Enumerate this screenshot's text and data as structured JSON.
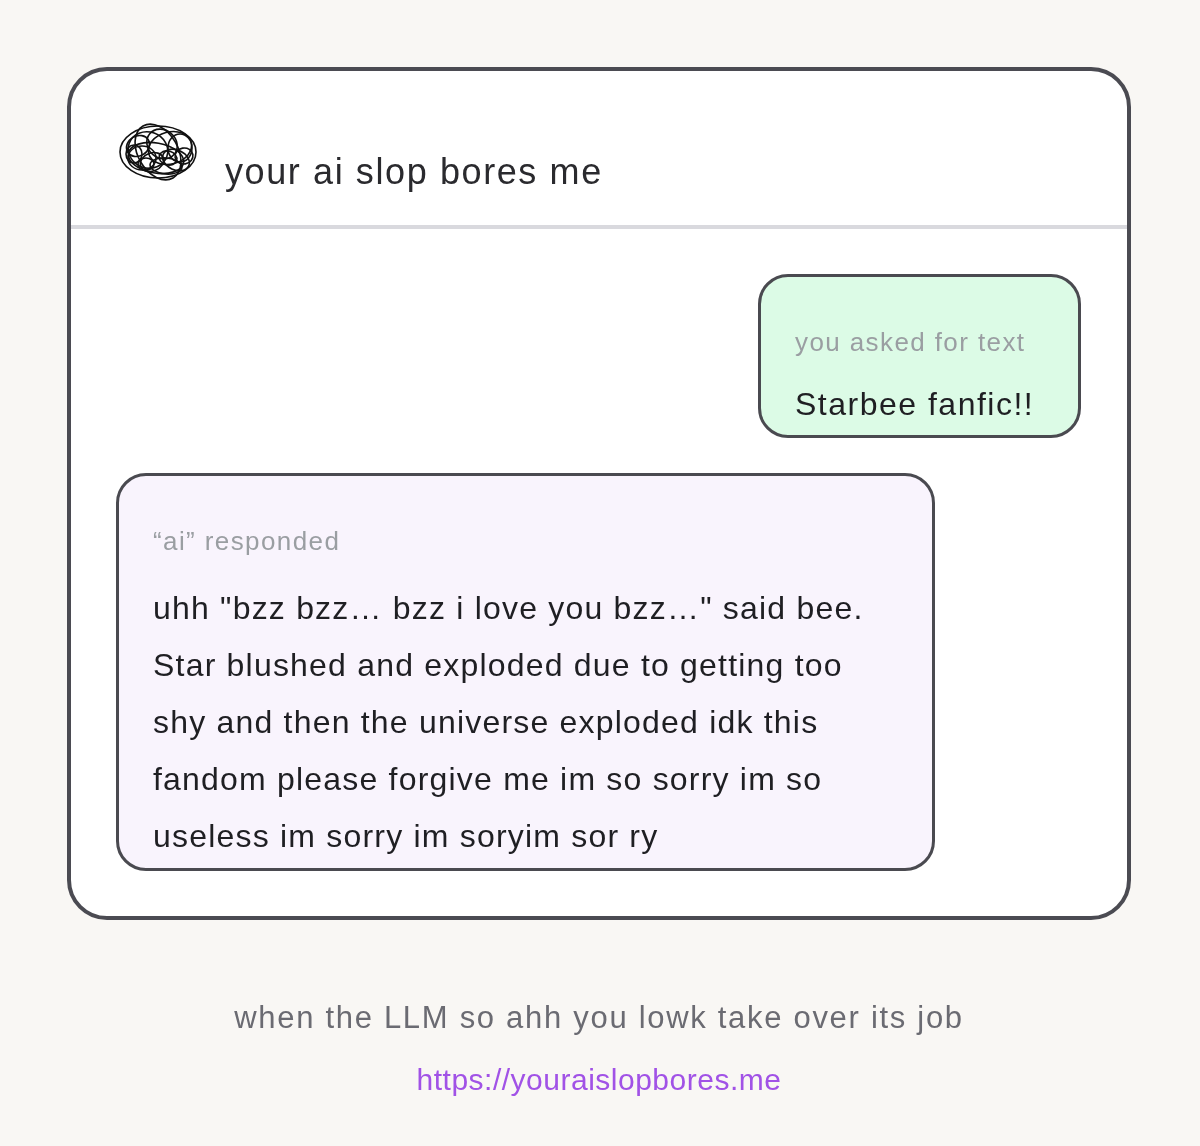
{
  "header": {
    "title": "your ai slop bores me"
  },
  "messages": [
    {
      "kind": "request",
      "label": "you asked for text",
      "text": "Starbee fanfic!!"
    },
    {
      "kind": "response",
      "label": "“ai” responded",
      "text": "uhh \"bzz bzz… bzz i love you bzz…\" said bee. Star blushed and exploded due to getting too shy and then the universe exploded idk this fandom please forgive me im so sorry im so useless im sorry im soryim sor ry"
    }
  ],
  "caption": "when the LLM so ahh you lowk take over its job",
  "link": "https://youraislopbores.me"
}
